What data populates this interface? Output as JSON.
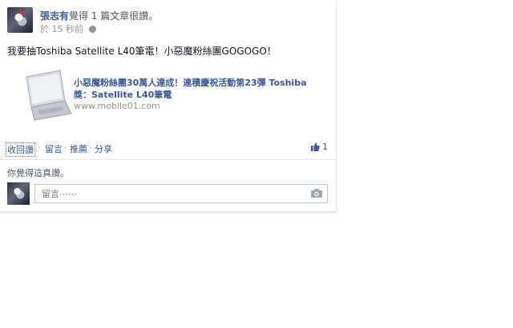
{
  "post": {
    "author": "張志有",
    "action": "覺得 1 篇文章很讚。",
    "time": "於 15 秒前",
    "privacy_icon": "globe-icon",
    "text": "我要抽Toshiba Satellite L40筆電！小惡魔粉絲團GOGOGO！"
  },
  "link": {
    "title": "小惡魔粉絲團30萬人達成！連積慶祝活動第23彈 Toshiba 獎：Satellite L40筆電",
    "domain": "www.mobile01.com",
    "thumbnail_icon": "laptop-icon"
  },
  "actions": {
    "collapse": "收回讚",
    "comment": "留言",
    "recommend": "推薦",
    "share": "分享",
    "separator": "·",
    "like_count": "1"
  },
  "like_note": "你覺得這真讚。",
  "comment": {
    "placeholder": "留言⋯⋯",
    "camera_icon": "camera-icon"
  },
  "colors": {
    "link_blue": "#3b5998",
    "meta_gray": "#90949c",
    "border": "#bdc7d8"
  }
}
